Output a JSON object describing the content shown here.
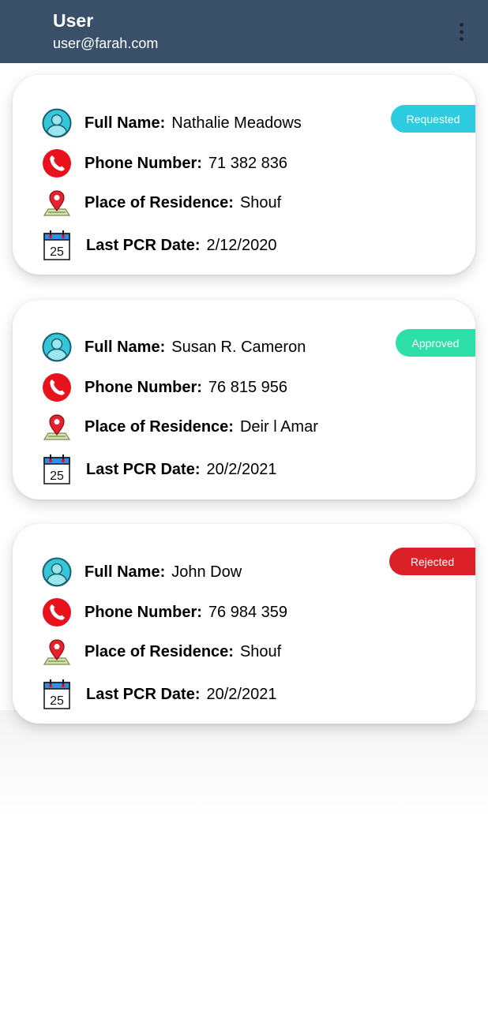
{
  "header": {
    "user_name": "User",
    "user_email": "user@farah.com",
    "menu_icon": "more-vertical-icon"
  },
  "labels": {
    "full_name": "Full Name:",
    "phone": "Phone Number:",
    "residence": "Place of Residence:",
    "pcr_date": "Last PCR Date:"
  },
  "icons": {
    "person": "person-icon",
    "phone": "phone-icon",
    "location": "map-pin-icon",
    "calendar": "calendar-icon",
    "calendar_day": "25"
  },
  "colors": {
    "appbar": "#3a5069",
    "requested": "#2ccbe0",
    "approved": "#2ee0a8",
    "rejected": "#dc2028"
  },
  "records": [
    {
      "status": "Requested",
      "full_name": "Nathalie Meadows",
      "phone": "71 382 836",
      "residence": "Shouf",
      "pcr_date": "2/12/2020"
    },
    {
      "status": "Approved",
      "full_name": "Susan R. Cameron",
      "phone": "76 815 956",
      "residence": "Deir l Amar",
      "pcr_date": "20/2/2021"
    },
    {
      "status": "Rejected",
      "full_name": "John Dow",
      "phone": "76 984 359",
      "residence": "Shouf",
      "pcr_date": "20/2/2021"
    }
  ]
}
